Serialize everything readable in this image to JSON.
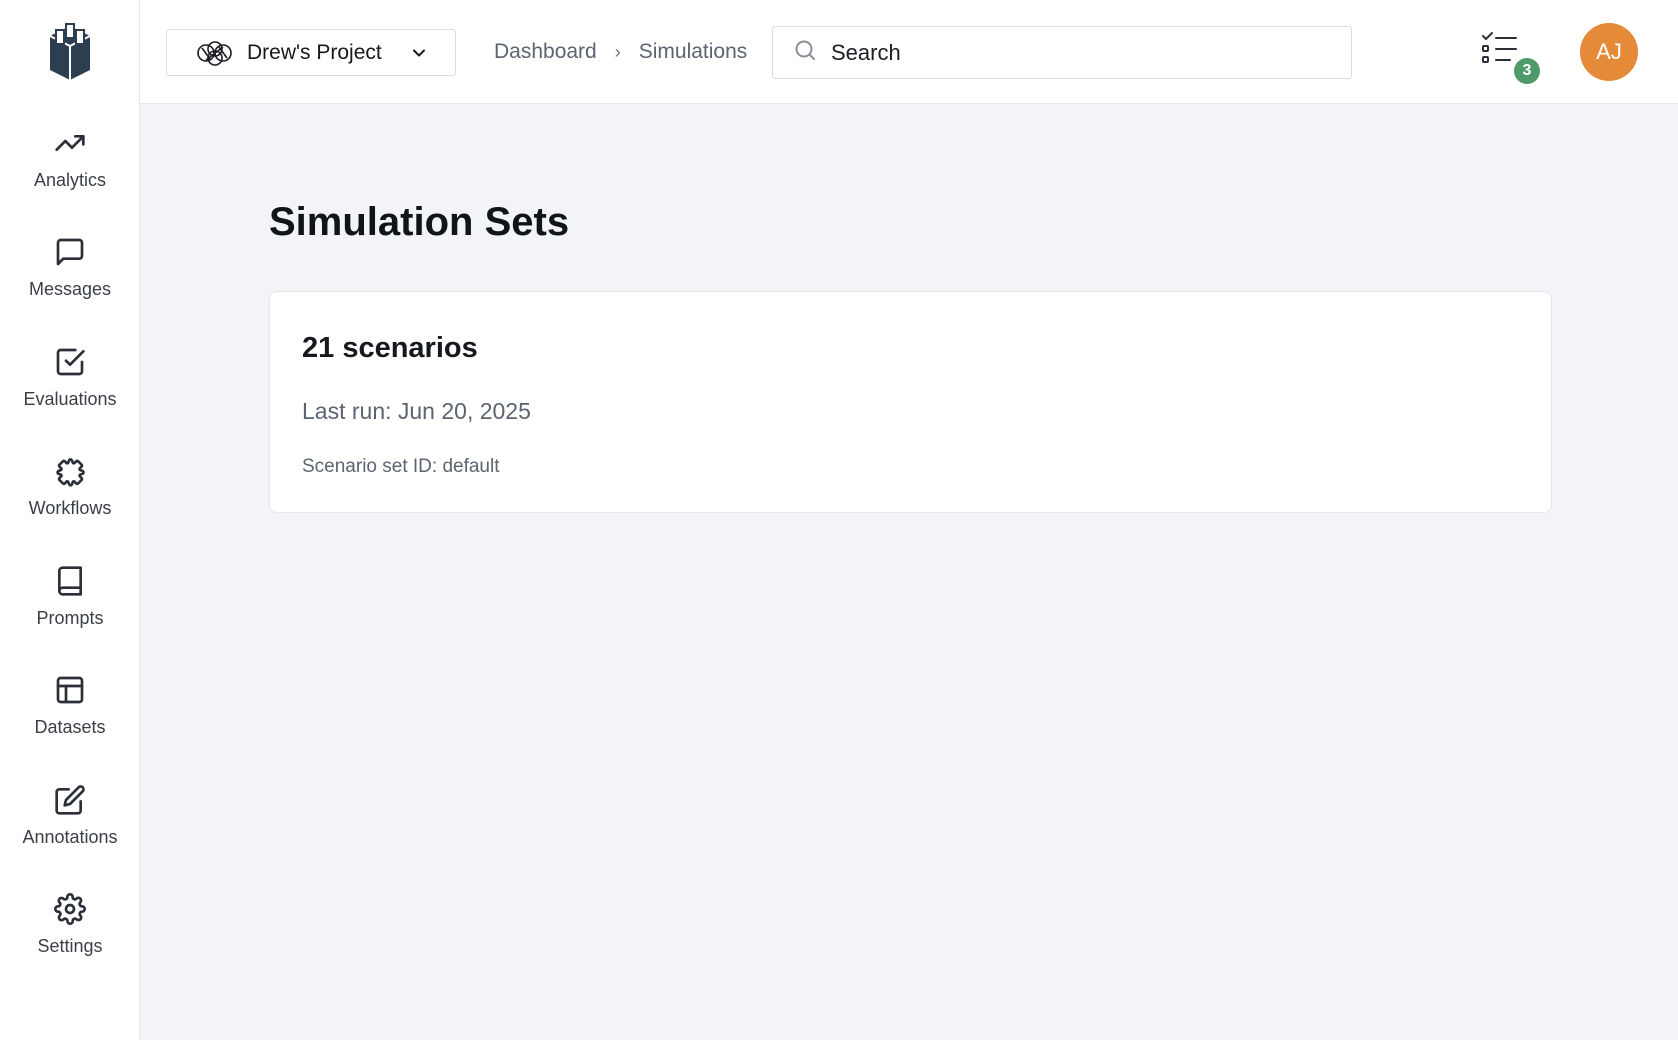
{
  "sidebar": {
    "logo": "building-logo",
    "items": [
      {
        "label": "Analytics",
        "icon": "trending-up-icon"
      },
      {
        "label": "Messages",
        "icon": "message-square-icon"
      },
      {
        "label": "Evaluations",
        "icon": "check-square-icon"
      },
      {
        "label": "Workflows",
        "icon": "puzzle-icon"
      },
      {
        "label": "Prompts",
        "icon": "book-icon"
      },
      {
        "label": "Datasets",
        "icon": "table-icon"
      },
      {
        "label": "Annotations",
        "icon": "edit-icon"
      },
      {
        "label": "Settings",
        "icon": "gear-icon"
      }
    ]
  },
  "header": {
    "project": {
      "name": "Drew's Project",
      "icon": "openai-knot-icon"
    },
    "breadcrumb": [
      "Dashboard",
      "Simulations"
    ],
    "search": {
      "placeholder": "Search",
      "value": ""
    },
    "tasks": {
      "icon": "task-list-icon",
      "count": "3",
      "badge_color": "#4f9a6a"
    },
    "avatar": {
      "initials": "AJ",
      "color": "#e48a38"
    }
  },
  "main": {
    "title": "Simulation Sets",
    "cards": [
      {
        "count": "21 scenarios",
        "last_run": "Last run: Jun 20, 2025",
        "set_id": "Scenario set ID: default"
      }
    ]
  }
}
